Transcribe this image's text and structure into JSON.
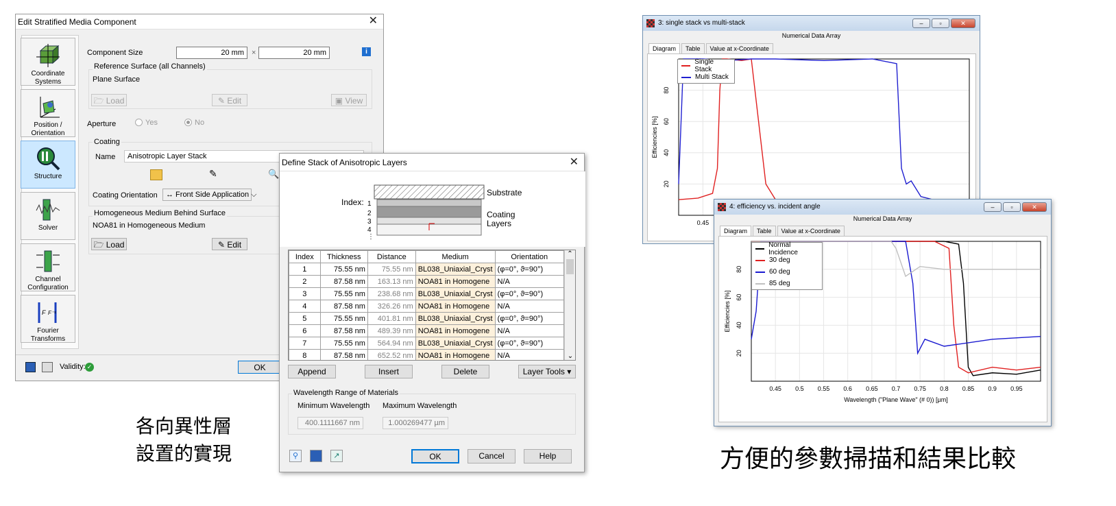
{
  "dialog1": {
    "title": "Edit Stratified Media Component",
    "close": "✕",
    "sidebar": [
      {
        "label": "Coordinate Systems"
      },
      {
        "label": "Position / Orientation"
      },
      {
        "label": "Structure"
      },
      {
        "label": "Solver"
      },
      {
        "label": "Channel Configuration"
      },
      {
        "label": "Fourier Transforms"
      }
    ],
    "component_size_label": "Component Size",
    "size_x": "20 mm",
    "size_times": "×",
    "size_y": "20 mm",
    "ref_surface_group": "Reference Surface (all Channels)",
    "ref_surface_value": "Plane Surface",
    "load": "Load",
    "edit": "Edit",
    "view": "View",
    "aperture_label": "Aperture",
    "aperture_yes": "Yes",
    "aperture_no": "No",
    "coating_group": "Coating",
    "name_label": "Name",
    "name_value": "Anisotropic Layer Stack",
    "coating_orientation_label": "Coating Orientation",
    "coating_orientation_value": "↔ Front Side Application",
    "homog_group": "Homogeneous Medium Behind Surface",
    "homog_value": "NOA81 in Homogeneous Medium",
    "load2": "Load",
    "edit2": "Edit",
    "validity_label": "Validity:",
    "ok": "OK"
  },
  "dialog2": {
    "title": "Define Stack of Anisotropic Layers",
    "close": "✕",
    "diagram": {
      "index_label": "Index:",
      "indices": [
        "1",
        "2",
        "3",
        "4",
        "⋮"
      ],
      "substrate": "Substrate",
      "coating_line1": "Coating",
      "coating_line2": "Layers"
    },
    "columns": [
      "Index",
      "Thickness",
      "Distance",
      "Medium",
      "Orientation"
    ],
    "rows": [
      [
        "1",
        "75.55 nm",
        "75.55 nm",
        "BL038_Uniaxial_Cryst",
        "(φ=0°, ϑ=90°)"
      ],
      [
        "2",
        "87.58 nm",
        "163.13 nm",
        "NOA81 in Homogene",
        "N/A"
      ],
      [
        "3",
        "75.55 nm",
        "238.68 nm",
        "BL038_Uniaxial_Cryst",
        "(φ=0°, ϑ=90°)"
      ],
      [
        "4",
        "87.58 nm",
        "326.26 nm",
        "NOA81 in Homogene",
        "N/A"
      ],
      [
        "5",
        "75.55 nm",
        "401.81 nm",
        "BL038_Uniaxial_Cryst",
        "(φ=0°, ϑ=90°)"
      ],
      [
        "6",
        "87.58 nm",
        "489.39 nm",
        "NOA81 in Homogene",
        "N/A"
      ],
      [
        "7",
        "75.55 nm",
        "564.94 nm",
        "BL038_Uniaxial_Cryst",
        "(φ=0°, ϑ=90°)"
      ],
      [
        "8",
        "87.58 nm",
        "652.52 nm",
        "NOA81 in Homogene",
        "N/A"
      ]
    ],
    "append": "Append",
    "insert": "Insert",
    "delete": "Delete",
    "layer_tools": "Layer Tools ▾",
    "wl_group": "Wavelength Range of Materials",
    "min_wl_label": "Minimum Wavelength",
    "max_wl_label": "Maximum Wavelength",
    "min_wl": "400.1111667 nm",
    "max_wl": "1.000269477 µm",
    "ok": "OK",
    "cancel": "Cancel",
    "help": "Help"
  },
  "caption_left_line1": "各向異性層",
  "caption_left_line2": "設置的實現",
  "caption_right": "方便的參數掃描和結果比較",
  "plot1_window": {
    "title": "3: single stack vs multi-stack",
    "header": "Numerical Data Array",
    "tabs": [
      "Diagram",
      "Table",
      "Value at x-Coordinate"
    ]
  },
  "plot2_window": {
    "title": "4: efficiency vs. incident angle",
    "header": "Numerical Data Array",
    "tabs": [
      "Diagram",
      "Table",
      "Value at x-Coordinate"
    ]
  },
  "chart_data": [
    {
      "type": "line",
      "ylabel": "Efficiencies  [%]",
      "xlim": [
        0.4,
        1.0
      ],
      "ylim": [
        0,
        100
      ],
      "yticks": [
        "20",
        "40",
        "60",
        "80"
      ],
      "xticks": [
        "0.45"
      ],
      "series": [
        {
          "name": "Single Stack",
          "color": "#e02020",
          "x": [
            0.4,
            0.44,
            0.47,
            0.48,
            0.485,
            0.49,
            0.5,
            0.53,
            0.55,
            0.58,
            0.6,
            0.65,
            0.7,
            0.75,
            0.8,
            0.85,
            0.9,
            0.95,
            1.0
          ],
          "y": [
            10,
            11,
            14,
            30,
            80,
            100,
            100,
            99,
            100,
            20,
            10,
            8,
            9,
            8,
            10,
            9,
            8,
            8,
            10
          ]
        },
        {
          "name": "Multi Stack",
          "color": "#2020d0",
          "x": [
            0.4,
            0.405,
            0.41,
            0.42,
            0.45,
            0.5,
            0.55,
            0.6,
            0.7,
            0.8,
            0.85,
            0.86,
            0.87,
            0.88,
            0.9,
            0.95,
            1.0
          ],
          "y": [
            20,
            60,
            100,
            100,
            100,
            99,
            100,
            100,
            99,
            100,
            97,
            30,
            20,
            22,
            12,
            8,
            8
          ]
        }
      ]
    },
    {
      "type": "line",
      "xlabel": "Wavelength (\"Plane Wave\" (# 0)) [µm]",
      "ylabel": "Efficiencies  [%]",
      "xlim": [
        0.4,
        1.0
      ],
      "ylim": [
        0,
        100
      ],
      "yticks": [
        "20",
        "40",
        "60",
        "80"
      ],
      "xticks": [
        "0.45",
        "0.5",
        "0.55",
        "0.6",
        "0.65",
        "0.7",
        "0.75",
        "0.8",
        "0.85",
        "0.9",
        "0.95"
      ],
      "series": [
        {
          "name": "Normal Incidence",
          "color": "#000000",
          "x": [
            0.4,
            0.5,
            0.6,
            0.7,
            0.8,
            0.83,
            0.84,
            0.85,
            0.86,
            0.9,
            0.95,
            1.0
          ],
          "y": [
            100,
            100,
            100,
            100,
            100,
            98,
            70,
            10,
            4,
            6,
            5,
            8
          ]
        },
        {
          "name": "30 deg",
          "color": "#e02020",
          "x": [
            0.4,
            0.5,
            0.6,
            0.7,
            0.78,
            0.81,
            0.82,
            0.83,
            0.85,
            0.9,
            0.95,
            1.0
          ],
          "y": [
            100,
            100,
            100,
            100,
            100,
            95,
            40,
            10,
            6,
            10,
            8,
            10
          ]
        },
        {
          "name": "60 deg",
          "color": "#1a1ad0",
          "x": [
            0.4,
            0.41,
            0.42,
            0.45,
            0.55,
            0.65,
            0.72,
            0.735,
            0.745,
            0.76,
            0.8,
            0.9,
            1.0
          ],
          "y": [
            30,
            50,
            100,
            100,
            100,
            100,
            100,
            70,
            20,
            30,
            25,
            30,
            32
          ]
        },
        {
          "name": "85 deg",
          "color": "#c0c0c0",
          "x": [
            0.4,
            0.5,
            0.6,
            0.69,
            0.7,
            0.72,
            0.75,
            0.8,
            0.9,
            1.0
          ],
          "y": [
            100,
            100,
            100,
            100,
            95,
            75,
            82,
            80,
            80,
            80
          ]
        }
      ]
    }
  ]
}
